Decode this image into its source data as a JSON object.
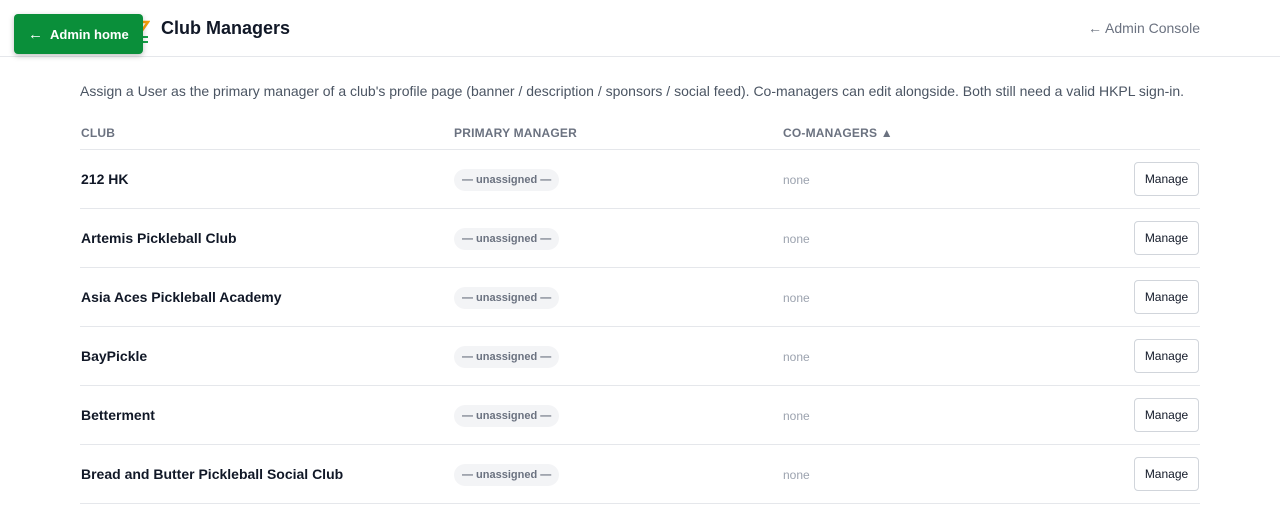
{
  "header": {
    "title": "Club Managers",
    "console_link": "← Admin Console"
  },
  "admin_home": {
    "arrow": "←",
    "label": "Admin home",
    "color": "#0a8f3a"
  },
  "intro": "Assign a User as the primary manager of a club's profile page (banner / description / sponsors / social feed). Co-managers can edit alongside. Both still need a valid HKPL sign-in.",
  "table": {
    "columns": {
      "club": "CLUB",
      "primary": "PRIMARY MANAGER",
      "co": "CO-MANAGERS ▲"
    },
    "rows": [
      {
        "club": "212 HK",
        "primary": "— unassigned —",
        "co": "none",
        "action": "Manage"
      },
      {
        "club": "Artemis Pickleball Club",
        "primary": "— unassigned —",
        "co": "none",
        "action": "Manage"
      },
      {
        "club": "Asia Aces Pickleball Academy",
        "primary": "— unassigned —",
        "co": "none",
        "action": "Manage"
      },
      {
        "club": "BayPickle",
        "primary": "— unassigned —",
        "co": "none",
        "action": "Manage"
      },
      {
        "club": "Betterment",
        "primary": "— unassigned —",
        "co": "none",
        "action": "Manage"
      },
      {
        "club": "Bread and Butter Pickleball Social Club",
        "primary": "— unassigned —",
        "co": "none",
        "action": "Manage"
      }
    ]
  }
}
